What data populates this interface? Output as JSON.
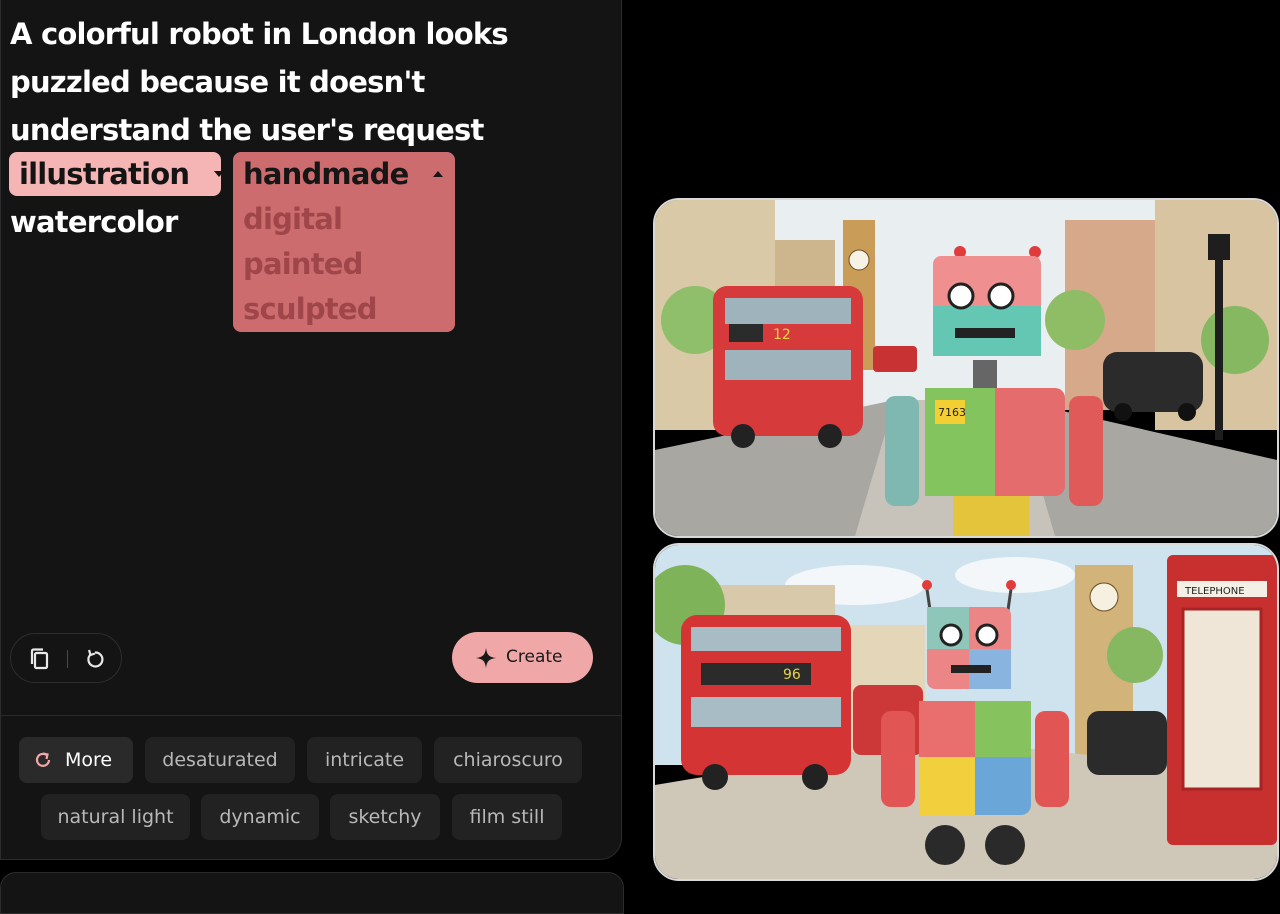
{
  "prompt": {
    "lines": [
      "A colorful robot in London looks",
      "puzzled because it doesn't",
      "understand the user's request"
    ]
  },
  "style_chip": {
    "label": "illustration"
  },
  "tail_word": "watercolor",
  "dropdown": {
    "selected": "handmade",
    "options": [
      "digital",
      "painted",
      "sculpted"
    ]
  },
  "actions": {
    "create_label": "Create"
  },
  "suggestions": {
    "more_label": "More",
    "row1": [
      "desaturated",
      "intricate",
      "chiaroscuro"
    ],
    "row2": [
      "natural light",
      "dynamic",
      "sketchy",
      "film still"
    ]
  },
  "images": {
    "top": {
      "bus_sign": "12",
      "robot_tag": "7163"
    },
    "bottom": {
      "bus_sign": "96",
      "telephone_sign": "TELEPHONE"
    }
  },
  "colors": {
    "chip": "#f6b5b5",
    "dropdown": "#cd6c6e",
    "create": "#f0a7a8",
    "panel": "#141414"
  }
}
